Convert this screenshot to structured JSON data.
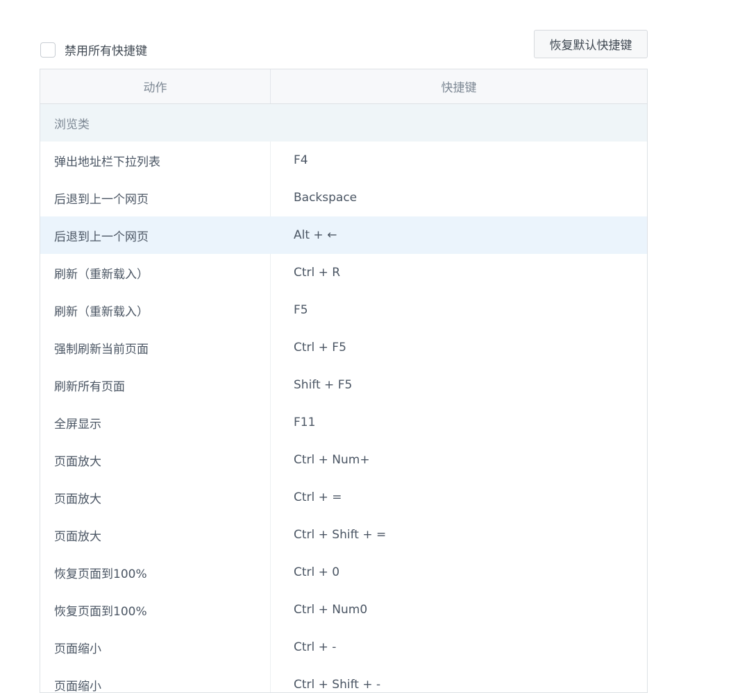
{
  "toolbar": {
    "disable_all_label": "禁用所有快捷键",
    "disable_all_checked": false,
    "restore_defaults_label": "恢复默认快捷键"
  },
  "table": {
    "headers": {
      "action": "动作",
      "shortcut": "快捷键"
    },
    "group": "浏览类",
    "rows": [
      {
        "action": "弹出地址栏下拉列表",
        "shortcut": "F4"
      },
      {
        "action": "后退到上一个网页",
        "shortcut": "Backspace"
      },
      {
        "action": "后退到上一个网页",
        "shortcut": "Alt + ←"
      },
      {
        "action": "刷新（重新载入）",
        "shortcut": "Ctrl + R"
      },
      {
        "action": "刷新（重新载入）",
        "shortcut": "F5"
      },
      {
        "action": "强制刷新当前页面",
        "shortcut": "Ctrl + F5"
      },
      {
        "action": "刷新所有页面",
        "shortcut": "Shift + F5"
      },
      {
        "action": "全屏显示",
        "shortcut": "F11"
      },
      {
        "action": "页面放大",
        "shortcut": "Ctrl + Num+"
      },
      {
        "action": "页面放大",
        "shortcut": "Ctrl + ="
      },
      {
        "action": "页面放大",
        "shortcut": "Ctrl + Shift + ="
      },
      {
        "action": "恢复页面到100%",
        "shortcut": "Ctrl + 0"
      },
      {
        "action": "恢复页面到100%",
        "shortcut": "Ctrl + Num0"
      },
      {
        "action": "页面缩小",
        "shortcut": "Ctrl + -"
      },
      {
        "action": "页面缩小",
        "shortcut": "Ctrl + Shift + -"
      }
    ],
    "highlighted_row_index": 2
  },
  "colors": {
    "highlight_row": "#ebf4fc",
    "group_row": "#eff5f8",
    "header_bg": "#f7f8fa",
    "border": "#dde1e5"
  }
}
